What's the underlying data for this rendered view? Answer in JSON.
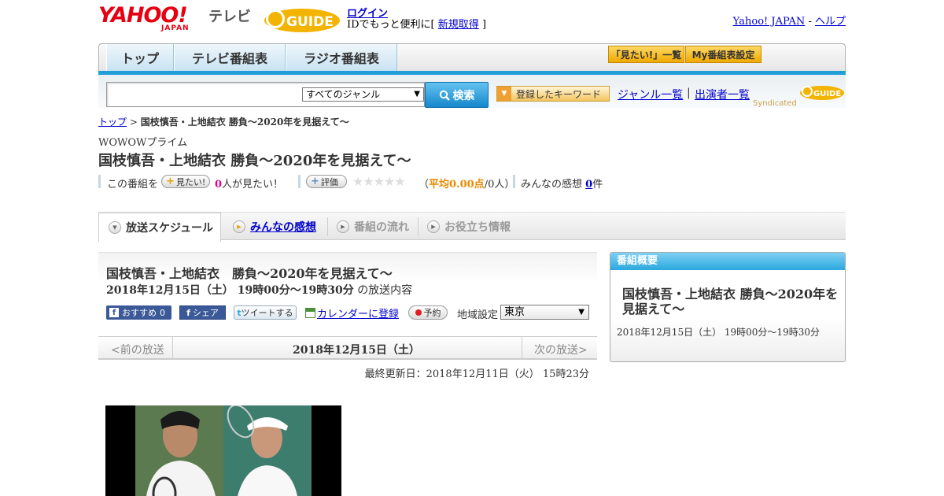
{
  "header": {
    "yahoo_logo": "YAHOO!",
    "yahoo_japan": "JAPAN",
    "tv_label": "テレビ",
    "gguide_logo": "GUIDE",
    "login": "ログイン",
    "id_text_pre": "IDでもっと便利に[",
    "signup": "新規取得",
    "id_text_post": "]",
    "yahoo_japan_link": "Yahoo! JAPAN",
    "dash": "-",
    "help": "ヘルプ"
  },
  "nav": {
    "tabs": [
      "トップ",
      "テレビ番組表",
      "ラジオ番組表"
    ],
    "want_list": "「見たい!」一覧",
    "my_schedule": "My番組表設定"
  },
  "search": {
    "genre_value": "すべてのジャンル",
    "button": "検索",
    "keyword_button": "登録したキーワード",
    "genre_list": "ジャンル一覧",
    "separator": "|",
    "cast_list": "出演者一覧",
    "syndicated": "Syndicated"
  },
  "breadcrumb": {
    "top": "トップ",
    "sep": ">",
    "current": "国枝慎吾・上地結衣 勝負～2020年を見据えて～"
  },
  "program": {
    "channel": "WOWOWプライム",
    "title": "国枝慎吾・上地結衣 勝負～2020年を見据えて～"
  },
  "stats": {
    "this_program": "この番組を",
    "want_button": "見たい!",
    "want_count": "0",
    "want_suffix": "人が見たい！",
    "rate_button": "評価",
    "stars": "★★★★★",
    "avg_open": "（",
    "avg_label": "平均0.00点",
    "avg_people": "/0人）",
    "reviews_label": "みんなの感想",
    "reviews_count": "0",
    "reviews_suffix": "件"
  },
  "tabs": {
    "schedule": "放送スケジュール",
    "reviews": "みんなの感想",
    "flow": "番組の流れ",
    "info": "お役立ち情報"
  },
  "schedule": {
    "title": "国枝慎吾・上地結衣　勝負～2020年を見据えて～",
    "datetime": "2018年12月15日（土）  19時00分～19時30分",
    "suffix": "の放送内容",
    "fb_recommend": "おすすめ",
    "fb_count": "0",
    "fb_share": "シェア",
    "tweet": "ツイートする",
    "calendar": "カレンダーに登録",
    "reserve": "予約",
    "region_label": "地域設定",
    "region_value": "東京",
    "prev": "<前の放送",
    "current_date": "2018年12月15日（土）",
    "next": "次の放送>",
    "updated": "最終更新日：2018年12月11日（火）  15時23分"
  },
  "sidebar": {
    "heading": "番組概要",
    "title": "国枝慎吾・上地結衣 勝負～2020年を見据えて～",
    "time": "2018年12月15日（土）  19時00分～19時30分"
  },
  "colors": {
    "accent_blue": "#1f9ed8",
    "yahoo_red": "#e60012",
    "gguide_yellow": "#f2b400",
    "facebook": "#3b5998"
  }
}
